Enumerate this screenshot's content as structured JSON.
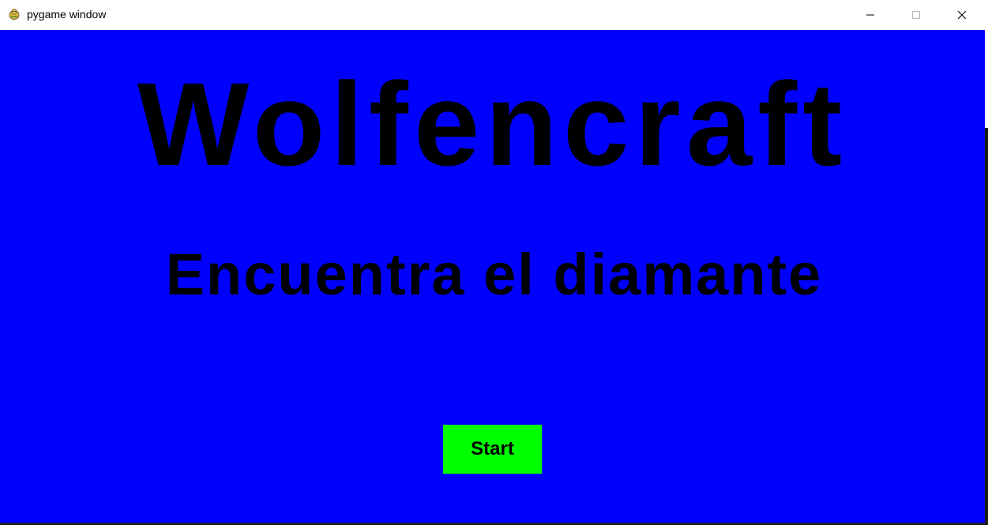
{
  "window": {
    "title": "pygame window",
    "icon": "pygame-snake-icon",
    "controls": {
      "minimize": "minimize-icon",
      "maximize": "maximize-icon",
      "close": "close-icon"
    }
  },
  "game": {
    "background_color": "#0000ff",
    "title": "Wolfencraft",
    "subtitle": "Encuentra el diamante",
    "start_button": {
      "label": "Start",
      "color": "#00ff00"
    }
  }
}
